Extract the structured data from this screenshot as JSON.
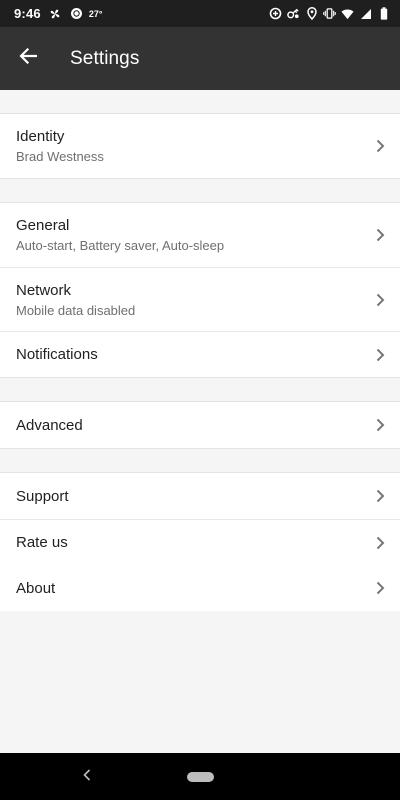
{
  "status_bar": {
    "time": "9:46",
    "temperature": "27°",
    "icons_left": [
      "fan-icon",
      "weather-icon"
    ],
    "icons_right": [
      "data-saver-icon",
      "vpn-key-icon",
      "location-icon",
      "vibrate-icon",
      "wifi-icon",
      "signal-icon",
      "battery-icon"
    ]
  },
  "app_bar": {
    "title": "Settings",
    "back_icon": "arrow-back-icon"
  },
  "settings": {
    "identity": {
      "title": "Identity",
      "subtitle": "Brad Westness"
    },
    "general": {
      "title": "General",
      "subtitle": "Auto-start, Battery saver, Auto-sleep"
    },
    "network": {
      "title": "Network",
      "subtitle": "Mobile data disabled"
    },
    "notifications": {
      "title": "Notifications"
    },
    "advanced": {
      "title": "Advanced"
    },
    "support": {
      "title": "Support"
    },
    "rate_us": {
      "title": "Rate us"
    },
    "about": {
      "title": "About"
    }
  },
  "colors": {
    "status_bar_bg": "#1f1f1f",
    "app_bar_bg": "#333333",
    "page_bg": "#f5f5f5",
    "row_bg": "#ffffff",
    "title_text": "#212121",
    "subtitle_text": "#6f6f6f",
    "chevron": "#757575",
    "nav_bar_bg": "#000000"
  }
}
